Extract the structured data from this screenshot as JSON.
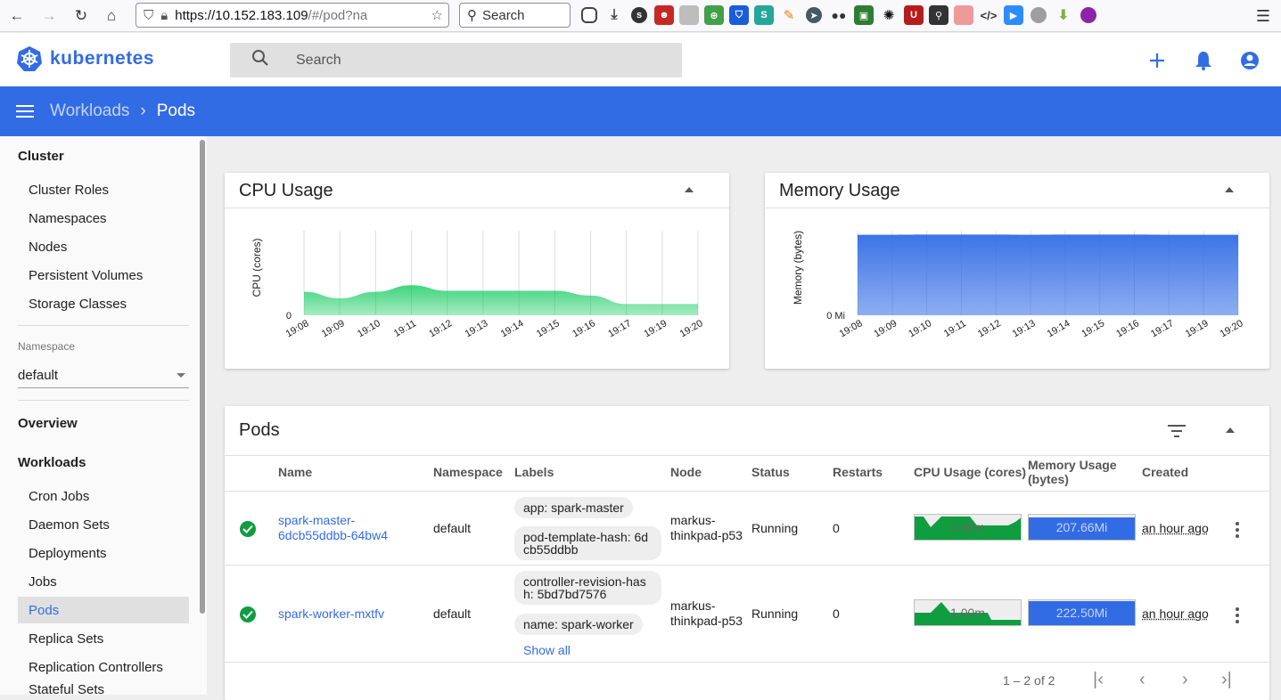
{
  "browser": {
    "url_host": "https://10.152.183.109",
    "url_rest": "/#/pod?na",
    "search_placeholder": "Search"
  },
  "header": {
    "logo_text": "kubernetes",
    "search_placeholder": "Search"
  },
  "toolbar": {
    "breadcrumb_parent": "Workloads",
    "breadcrumb_current": "Pods"
  },
  "sidebar": {
    "cluster_heading": "Cluster",
    "cluster_items": [
      "Cluster Roles",
      "Namespaces",
      "Nodes",
      "Persistent Volumes",
      "Storage Classes"
    ],
    "namespace_label": "Namespace",
    "namespace_value": "default",
    "overview": "Overview",
    "workloads_heading": "Workloads",
    "workload_items": [
      "Cron Jobs",
      "Daemon Sets",
      "Deployments",
      "Jobs",
      "Pods",
      "Replica Sets",
      "Replication Controllers",
      "Stateful Sets"
    ],
    "active_item": "Pods"
  },
  "cpu_card": {
    "title": "CPU Usage"
  },
  "memory_card": {
    "title": "Memory Usage"
  },
  "chart_data": [
    {
      "type": "area",
      "ylabel": "CPU (cores)",
      "yticks": [
        "0"
      ],
      "x": [
        "19:08",
        "19:09",
        "19:10",
        "19:11",
        "19:12",
        "19:13",
        "19:14",
        "19:15",
        "19:16",
        "19:17",
        "19:19",
        "19:20"
      ],
      "values": [
        0.0025,
        0.0018,
        0.0025,
        0.0032,
        0.0026,
        0.0026,
        0.0026,
        0.0026,
        0.0021,
        0.0012,
        0.0012,
        0.0012
      ],
      "ylim": [
        0,
        0.009
      ],
      "color": "#00c752"
    },
    {
      "type": "area",
      "ylabel": "Memory (bytes)",
      "yticks": [
        "0 Mi"
      ],
      "x": [
        "19:08",
        "19:09",
        "19:10",
        "19:11",
        "19:12",
        "19:13",
        "19:14",
        "19:15",
        "19:16",
        "19:17",
        "19:19",
        "19:20"
      ],
      "values": [
        430,
        430,
        431,
        431,
        431,
        430,
        431,
        431,
        431,
        430,
        430,
        430
      ],
      "ylim": [
        0,
        452
      ],
      "color": "#326ce5"
    }
  ],
  "pods_card": {
    "title": "Pods",
    "columns": [
      "Name",
      "Namespace",
      "Labels",
      "Node",
      "Status",
      "Restarts",
      "CPU Usage (cores)",
      "Memory Usage (bytes)",
      "Created"
    ],
    "rows": [
      {
        "name_line1": "spark-master-",
        "name_line2": "6dcb55ddbb-64bw4",
        "namespace": "default",
        "labels": [
          "app: spark-master",
          "pod-template-hash: 6d cb55ddbb"
        ],
        "node_line1": "markus-",
        "node_line2": "thinkpad-p53",
        "status": "Running",
        "restarts": "0",
        "cpu": "2.00m",
        "memory": "207.66Mi",
        "created": "an hour ago"
      },
      {
        "name_line1": "spark-worker-mxtfv",
        "name_line2": "",
        "namespace": "default",
        "labels": [
          "controller-revision-has h: 5bd7bd7576",
          "name: spark-worker"
        ],
        "show_all": "Show all",
        "node_line1": "markus-",
        "node_line2": "thinkpad-p53",
        "status": "Running",
        "restarts": "0",
        "cpu": "1.00m",
        "memory": "222.50Mi",
        "created": "an hour ago"
      }
    ],
    "pagination": "1 – 2 of 2"
  }
}
